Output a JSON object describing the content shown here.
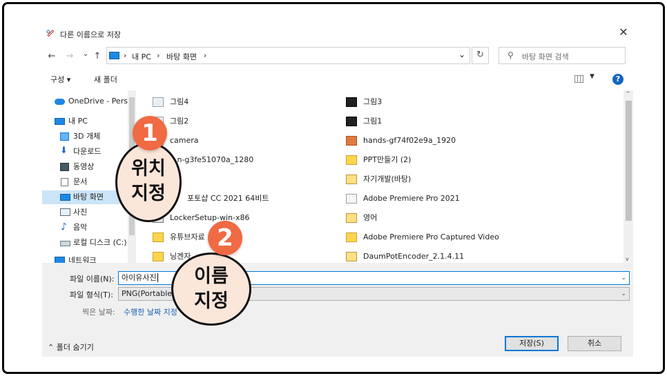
{
  "dialog": {
    "title": "다른 이름으로 저장",
    "close_glyph": "✕"
  },
  "nav": {
    "back_glyph": "←",
    "forward_glyph": "→",
    "recent_glyph": "⌄",
    "up_glyph": "↑",
    "address_segments": [
      "›",
      "내 PC",
      "›",
      "바탕 화면",
      "›"
    ],
    "address_dropdown_glyph": "⌄",
    "refresh_glyph": "↻",
    "search_placeholder": "바탕 화면 검색",
    "search_glyph": "⚲"
  },
  "toolbar": {
    "organize_label": "구성 ▾",
    "new_folder_label": "새 폴더",
    "view_caret": "▼",
    "help_glyph": "?"
  },
  "sidebar": {
    "items": [
      {
        "label": "OneDrive - Person",
        "icon": "cloud-icon",
        "indent": 1
      },
      {
        "label": "내 PC",
        "icon": "pc-icon",
        "indent": 1
      },
      {
        "label": "3D 개체",
        "icon": "cube-icon",
        "indent": 2
      },
      {
        "label": "다운로드",
        "icon": "download-icon",
        "indent": 2
      },
      {
        "label": "동영상",
        "icon": "video-icon",
        "indent": 2
      },
      {
        "label": "문서",
        "icon": "document-icon",
        "indent": 2
      },
      {
        "label": "바탕 화면",
        "icon": "desktop-icon",
        "indent": 2,
        "selected": true
      },
      {
        "label": "사진",
        "icon": "pictures-icon",
        "indent": 2
      },
      {
        "label": "음악",
        "icon": "music-icon",
        "indent": 2
      },
      {
        "label": "로컬 디스크 (C:)",
        "icon": "disk-icon",
        "indent": 2
      },
      {
        "label": "네트워크",
        "icon": "network-icon",
        "indent": 1
      }
    ]
  },
  "files": {
    "left": [
      {
        "label": "그림4",
        "icon": "image-file-icon"
      },
      {
        "label": "그림2",
        "icon": "image-file-icon"
      },
      {
        "label": "camera",
        "icon": "image-file-icon"
      },
      {
        "label": "...n-g3fe51070a_1280",
        "icon": "image-file-icon"
      },
      {
        "label": "",
        "icon": "image-file-icon"
      },
      {
        "label": "포토샵 CC 2021 64비트",
        "icon": "shortcut-icon"
      },
      {
        "label": "LockerSetup-win-x86",
        "icon": "setup-icon"
      },
      {
        "label": "유튜브자료",
        "icon": "folder-icon"
      },
      {
        "label": "닝겐자...",
        "icon": "folder-icon"
      }
    ],
    "right": [
      {
        "label": "그림3",
        "icon": "image-file-icon"
      },
      {
        "label": "그림1",
        "icon": "image-file-icon"
      },
      {
        "label": "hands-gf74f02e9a_1920",
        "icon": "photo-file-icon"
      },
      {
        "label": "PPT만들기 (2)",
        "icon": "folder-icon"
      },
      {
        "label": "자기개발(바탕)",
        "icon": "zip-folder-icon"
      },
      {
        "label": "Adobe Premiere Pro 2021",
        "icon": "app-icon"
      },
      {
        "label": "영어",
        "icon": "zip-folder-icon"
      },
      {
        "label": "Adobe Premiere Pro Captured Video",
        "icon": "folder-icon"
      },
      {
        "label": "DaumPotEncoder_2.1.4.11",
        "icon": "zip-folder-icon"
      }
    ]
  },
  "scroll": {
    "up_glyph": "^",
    "down_glyph": "v"
  },
  "save": {
    "filename_label": "파일 이름(N):",
    "filename_value": "아이유사진",
    "filetype_label": "파일 형식(T):",
    "filetype_value": "PNG(Portable N",
    "date_label": "찍은 날짜:",
    "date_value": "수행한 날짜 지정",
    "dropdown_glyph": "⌄",
    "save_button": "저장(S)",
    "cancel_button": "취소",
    "hide_folders": "⌃ 폴더 숨기기"
  },
  "annotations": {
    "badge1": "1",
    "bubble1_line1": "위치",
    "bubble1_line2": "지정",
    "badge2": "2",
    "bubble2_line1": "이름",
    "bubble2_line2": "지정",
    "badge_color": "#f06a43",
    "bubble_color": "#fbe6da"
  }
}
